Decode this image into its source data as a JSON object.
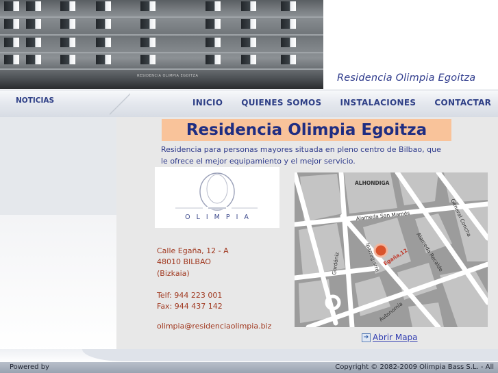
{
  "header": {
    "site_title": "Residencia Olimpia Egoitza",
    "photo_sign": "RESIDENCIA OLIMPIA EGOITZA"
  },
  "nav": {
    "side_label": "NOTICIAS",
    "items": [
      {
        "label": "INICIO"
      },
      {
        "label": "QUIENES SOMOS"
      },
      {
        "label": "INSTALACIONES"
      },
      {
        "label": "CONTACTAR"
      }
    ]
  },
  "main": {
    "heading": "Residencia Olimpia Egoitza",
    "intro": "Residencia para personas mayores situada en pleno centro de Bilbao, que le ofrece el mejor equipamiento y el mejor servicio.",
    "logo_text": "OLIMPIA",
    "address": {
      "street": "Calle Egaña, 12 - A",
      "city": "48010 BILBAO",
      "province": "(Bizkaia)",
      "phone": "Telf: 944 223 001",
      "fax": "Fax: 944 437 142",
      "email": "olimpia@residenciaolimpia.biz"
    },
    "map": {
      "streets": [
        "ALHONDIGA",
        "Alameda San Mamés",
        "General Concha",
        "Gordóniz",
        "Iparraguirre",
        "Egaña,12",
        "Alameda Recalde",
        "Autonomía"
      ],
      "link_label": "Abrir Mapa",
      "link_icon": "arrow-right-icon",
      "marker_color": "#d9532c"
    }
  },
  "footer": {
    "left": "Powered by",
    "right": "Copyright © 2082-2009 Olimpia Bass S.L. - All"
  },
  "colors": {
    "brand_blue": "#2e3f86",
    "heading_bg": "#f9c39a",
    "address_red": "#a0381f",
    "content_bg": "#e8e8e8"
  }
}
